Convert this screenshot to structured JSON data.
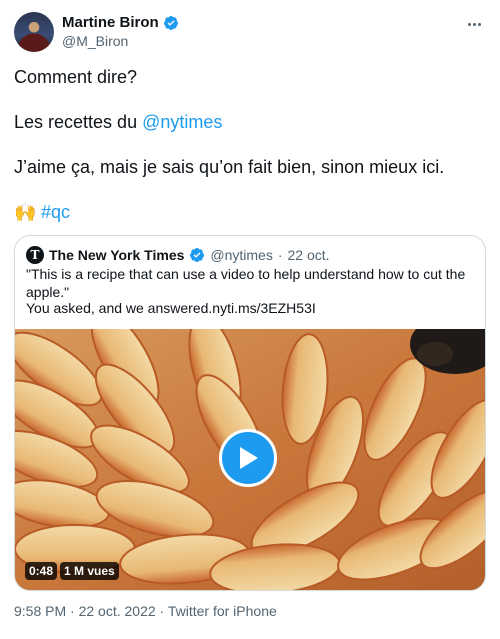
{
  "author": {
    "name": "Martine Biron",
    "handle": "@M_Biron",
    "verified": true
  },
  "tweet": {
    "line1": "Comment dire?",
    "line2_prefix": "Les recettes du ",
    "line2_mention": "@nytimes",
    "line3": "J’aime ça, mais je sais qu’on fait bien, sinon mieux ici.",
    "line4_emoji": "🙌",
    "line4_hashtag": "#qc"
  },
  "quoted": {
    "logo_letter": "T",
    "name": "The New York Times",
    "handle": "@nytimes",
    "separator": "·",
    "date": "22 oct.",
    "text1": "\"This is a recipe that can use a video to help understand how to cut the apple.\"",
    "text2": "You asked, and we answered.nyti.ms/3EZH53I",
    "video": {
      "duration": "0:48",
      "views": "1 M vues"
    }
  },
  "footer": {
    "text": "9:58 PM · 22 oct. 2022 · Twitter for iPhone"
  },
  "colors": {
    "accent": "#1d9bf0",
    "text": "#0f1419",
    "muted": "#536471",
    "border": "#cfd9de"
  },
  "icons": [
    "verified-badge-icon",
    "more-options-icon",
    "play-icon"
  ]
}
